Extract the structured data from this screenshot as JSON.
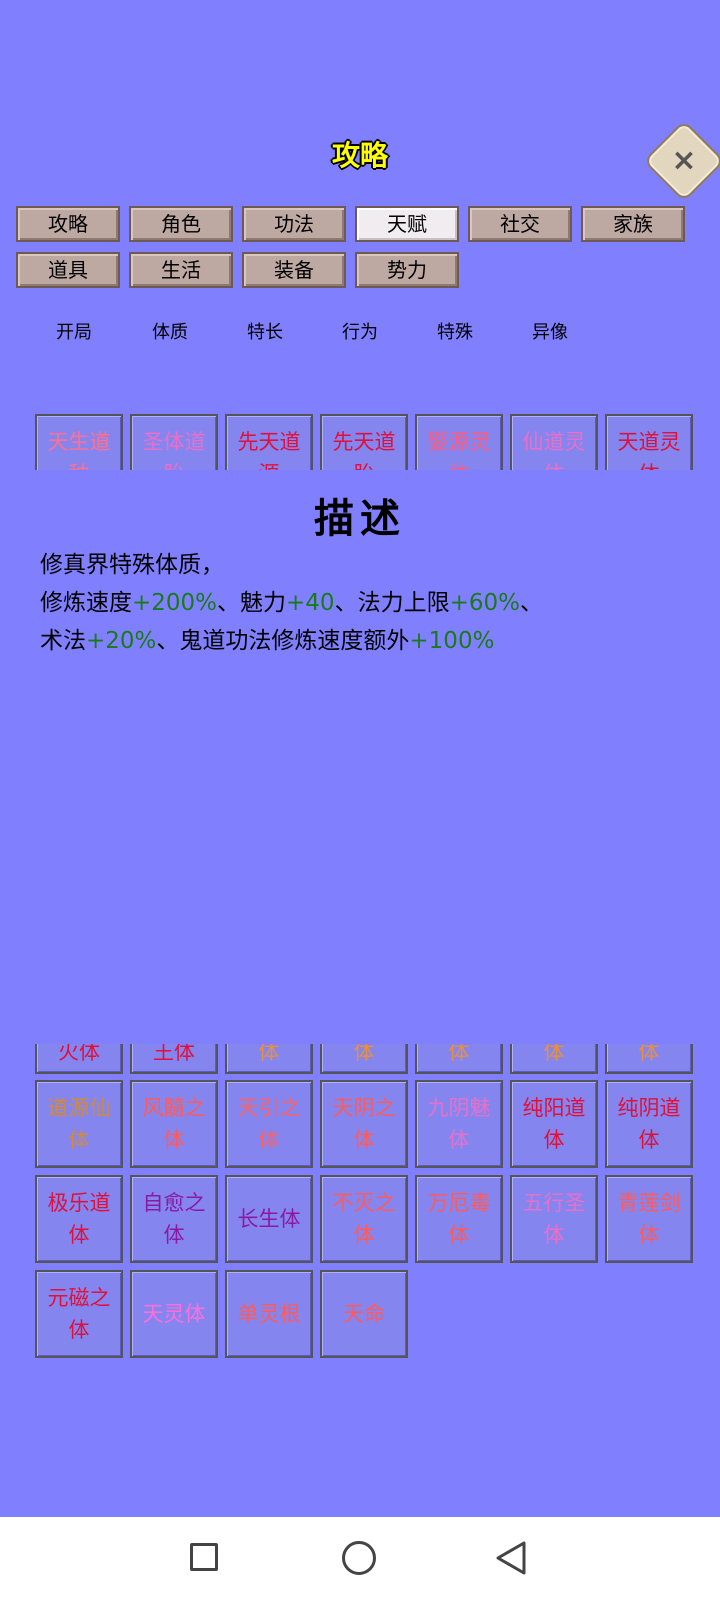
{
  "header": {
    "title": "攻略",
    "close_label": "×"
  },
  "tabs": [
    {
      "label": "攻略",
      "active": false
    },
    {
      "label": "角色",
      "active": false
    },
    {
      "label": "功法",
      "active": false
    },
    {
      "label": "天赋",
      "active": true
    },
    {
      "label": "社交",
      "active": false
    },
    {
      "label": "家族",
      "active": false
    },
    {
      "label": "道具",
      "active": false
    },
    {
      "label": "生活",
      "active": false
    },
    {
      "label": "装备",
      "active": false
    },
    {
      "label": "势力",
      "active": false
    }
  ],
  "subtabs": [
    "开局",
    "体质",
    "特长",
    "行为",
    "特殊",
    "异像"
  ],
  "top_strip": [
    {
      "text": "天生道\n种",
      "color": "#ff7090"
    },
    {
      "text": "圣体道\n胎",
      "color": "#e870c8"
    },
    {
      "text": "先天道\n源",
      "color": "#e0103a"
    },
    {
      "text": "先天道\n胎",
      "color": "#e0103a"
    },
    {
      "text": "婴源灵\n体",
      "color": "#ff5a80"
    },
    {
      "text": "仙道灵\n体",
      "color": "#e870c8"
    },
    {
      "text": "天道灵\n体",
      "color": "#e0103a"
    }
  ],
  "description": {
    "heading": "描述",
    "line1": "修真界特殊体质，",
    "line2_a": "修炼速度",
    "line2_b": "+200%",
    "line2_c": "、魅力",
    "line2_d": "+40",
    "line2_e": "、法力上限",
    "line2_f": "+60%",
    "line2_g": "、",
    "line3_a": "术法",
    "line3_b": "+20%",
    "line3_c": "、鬼道功法修炼速度额外",
    "line3_d": "+100%"
  },
  "bottom_partial_row": [
    {
      "text": "火体",
      "color": "#e0103a"
    },
    {
      "text": "王体",
      "color": "#e0103a"
    },
    {
      "text": "体",
      "color": "#e8903a"
    },
    {
      "text": "体",
      "color": "#e8903a"
    },
    {
      "text": "体",
      "color": "#e8903a"
    },
    {
      "text": "体",
      "color": "#e8903a"
    },
    {
      "text": "体",
      "color": "#e8903a"
    }
  ],
  "grid_rows": [
    [
      {
        "text": "道源仙\n体",
        "color": "#d08a3a"
      },
      {
        "text": "风髓之\n体",
        "color": "#ff5a5a"
      },
      {
        "text": "天引之\n体",
        "color": "#ff6060"
      },
      {
        "text": "天阴之\n体",
        "color": "#ff5a5a"
      },
      {
        "text": "九阴魅\n体",
        "color": "#e870c8"
      },
      {
        "text": "纯阳道\n体",
        "color": "#e0103a"
      },
      {
        "text": "纯阴道\n体",
        "color": "#e0103a"
      }
    ],
    [
      {
        "text": "极乐道\n体",
        "color": "#e0103a"
      },
      {
        "text": "自愈之\n体",
        "color": "#8a1aa0"
      },
      {
        "text": "长生体",
        "color": "#8a1aa0"
      },
      {
        "text": "不灭之\n体",
        "color": "#ff5a5a"
      },
      {
        "text": "万厄毒\n体",
        "color": "#ff5a5a"
      },
      {
        "text": "五行圣\n体",
        "color": "#e870c8"
      },
      {
        "text": "青莲剑\n体",
        "color": "#ff5a5a"
      }
    ],
    [
      {
        "text": "元磁之\n体",
        "color": "#e0103a"
      },
      {
        "text": "天灵体",
        "color": "#ff6fd8"
      },
      {
        "text": "单灵根",
        "color": "#ff5a5a"
      },
      {
        "text": "天命",
        "color": "#ff5a5a"
      }
    ]
  ],
  "navbar": {
    "square": "recent-apps",
    "circle": "home",
    "triangle": "back"
  }
}
